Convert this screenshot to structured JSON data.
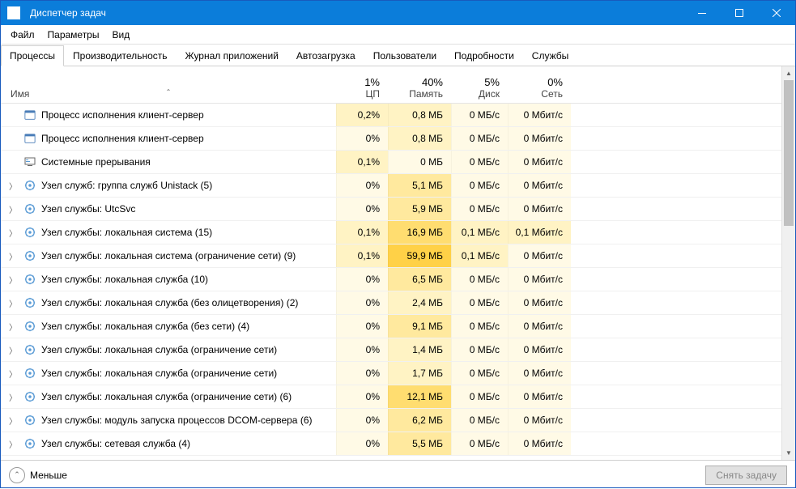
{
  "window": {
    "title": "Диспетчер задач"
  },
  "menu": {
    "file": "Файл",
    "options": "Параметры",
    "view": "Вид"
  },
  "tabs": {
    "processes": "Процессы",
    "performance": "Производительность",
    "app_history": "Журнал приложений",
    "startup": "Автозагрузка",
    "users": "Пользователи",
    "details": "Подробности",
    "services": "Службы"
  },
  "columns": {
    "name": "Имя",
    "cpu_val": "1%",
    "cpu_lbl": "ЦП",
    "mem_val": "40%",
    "mem_lbl": "Память",
    "disk_val": "5%",
    "disk_lbl": "Диск",
    "net_val": "0%",
    "net_lbl": "Сеть"
  },
  "rows": [
    {
      "expand": false,
      "icon": "app",
      "name": "Процесс исполнения клиент-сервер",
      "cpu": "0,2%",
      "cpu_bg": 1,
      "mem": "0,8 МБ",
      "mem_bg": 1,
      "disk": "0 МБ/с",
      "disk_bg": 0,
      "net": "0 Мбит/с",
      "net_bg": 0
    },
    {
      "expand": false,
      "icon": "app",
      "name": "Процесс исполнения клиент-сервер",
      "cpu": "0%",
      "cpu_bg": 0,
      "mem": "0,8 МБ",
      "mem_bg": 1,
      "disk": "0 МБ/с",
      "disk_bg": 0,
      "net": "0 Мбит/с",
      "net_bg": 0
    },
    {
      "expand": false,
      "icon": "sys",
      "name": "Системные прерывания",
      "cpu": "0,1%",
      "cpu_bg": 1,
      "mem": "0 МБ",
      "mem_bg": 0,
      "disk": "0 МБ/с",
      "disk_bg": 0,
      "net": "0 Мбит/с",
      "net_bg": 0
    },
    {
      "expand": true,
      "icon": "gear",
      "name": "Узел служб: группа служб Unistack (5)",
      "cpu": "0%",
      "cpu_bg": 0,
      "mem": "5,1 МБ",
      "mem_bg": 2,
      "disk": "0 МБ/с",
      "disk_bg": 0,
      "net": "0 Мбит/с",
      "net_bg": 0
    },
    {
      "expand": true,
      "icon": "gear",
      "name": "Узел службы: UtcSvc",
      "cpu": "0%",
      "cpu_bg": 0,
      "mem": "5,9 МБ",
      "mem_bg": 2,
      "disk": "0 МБ/с",
      "disk_bg": 0,
      "net": "0 Мбит/с",
      "net_bg": 0
    },
    {
      "expand": true,
      "icon": "gear",
      "name": "Узел службы: локальная система (15)",
      "cpu": "0,1%",
      "cpu_bg": 1,
      "mem": "16,9 МБ",
      "mem_bg": 3,
      "disk": "0,1 МБ/с",
      "disk_bg": 1,
      "net": "0,1 Мбит/с",
      "net_bg": 1
    },
    {
      "expand": true,
      "icon": "gear",
      "name": "Узел службы: локальная система (ограничение сети) (9)",
      "cpu": "0,1%",
      "cpu_bg": 1,
      "mem": "59,9 МБ",
      "mem_bg": 4,
      "disk": "0,1 МБ/с",
      "disk_bg": 1,
      "net": "0 Мбит/с",
      "net_bg": 0
    },
    {
      "expand": true,
      "icon": "gear",
      "name": "Узел службы: локальная служба (10)",
      "cpu": "0%",
      "cpu_bg": 0,
      "mem": "6,5 МБ",
      "mem_bg": 2,
      "disk": "0 МБ/с",
      "disk_bg": 0,
      "net": "0 Мбит/с",
      "net_bg": 0
    },
    {
      "expand": true,
      "icon": "gear",
      "name": "Узел службы: локальная служба (без олицетворения) (2)",
      "cpu": "0%",
      "cpu_bg": 0,
      "mem": "2,4 МБ",
      "mem_bg": 1,
      "disk": "0 МБ/с",
      "disk_bg": 0,
      "net": "0 Мбит/с",
      "net_bg": 0
    },
    {
      "expand": true,
      "icon": "gear",
      "name": "Узел службы: локальная служба (без сети) (4)",
      "cpu": "0%",
      "cpu_bg": 0,
      "mem": "9,1 МБ",
      "mem_bg": 2,
      "disk": "0 МБ/с",
      "disk_bg": 0,
      "net": "0 Мбит/с",
      "net_bg": 0
    },
    {
      "expand": true,
      "icon": "gear",
      "name": "Узел службы: локальная служба (ограничение сети)",
      "cpu": "0%",
      "cpu_bg": 0,
      "mem": "1,4 МБ",
      "mem_bg": 1,
      "disk": "0 МБ/с",
      "disk_bg": 0,
      "net": "0 Мбит/с",
      "net_bg": 0
    },
    {
      "expand": true,
      "icon": "gear",
      "name": "Узел службы: локальная служба (ограничение сети)",
      "cpu": "0%",
      "cpu_bg": 0,
      "mem": "1,7 МБ",
      "mem_bg": 1,
      "disk": "0 МБ/с",
      "disk_bg": 0,
      "net": "0 Мбит/с",
      "net_bg": 0
    },
    {
      "expand": true,
      "icon": "gear",
      "name": "Узел службы: локальная служба (ограничение сети) (6)",
      "cpu": "0%",
      "cpu_bg": 0,
      "mem": "12,1 МБ",
      "mem_bg": 3,
      "disk": "0 МБ/с",
      "disk_bg": 0,
      "net": "0 Мбит/с",
      "net_bg": 0
    },
    {
      "expand": true,
      "icon": "gear",
      "name": "Узел службы: модуль запуска процессов DCOM-сервера (6)",
      "cpu": "0%",
      "cpu_bg": 0,
      "mem": "6,2 МБ",
      "mem_bg": 2,
      "disk": "0 МБ/с",
      "disk_bg": 0,
      "net": "0 Мбит/с",
      "net_bg": 0
    },
    {
      "expand": true,
      "icon": "gear",
      "name": "Узел службы: сетевая служба (4)",
      "cpu": "0%",
      "cpu_bg": 0,
      "mem": "5,5 МБ",
      "mem_bg": 2,
      "disk": "0 МБ/с",
      "disk_bg": 0,
      "net": "0 Мбит/с",
      "net_bg": 0
    }
  ],
  "footer": {
    "less": "Меньше",
    "end_task": "Снять задачу"
  }
}
